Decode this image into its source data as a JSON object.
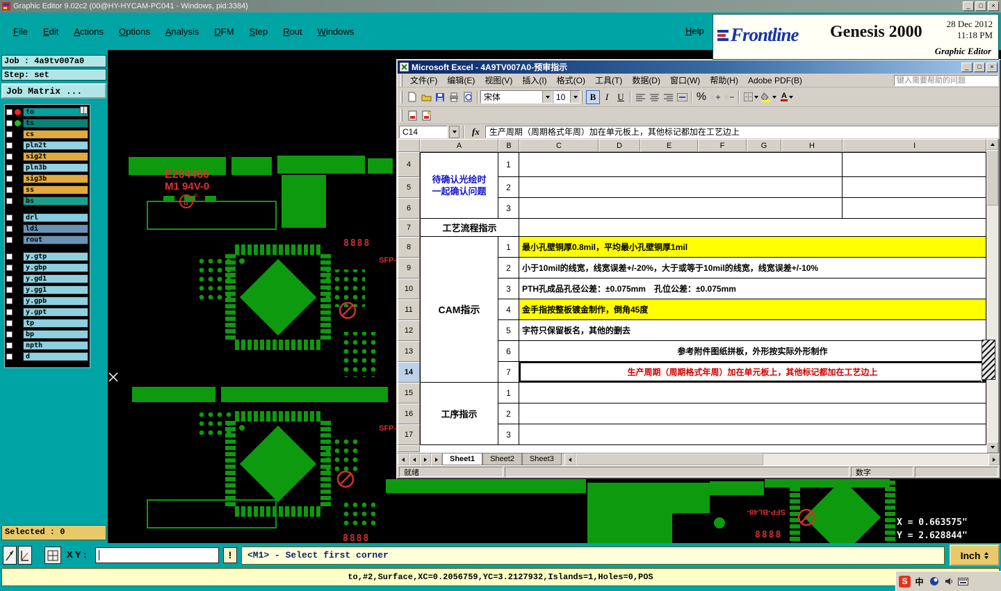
{
  "window": {
    "title": "Graphic Editor 9.02c2 (00@HY-HYCAM-PC041 - Windows, pid:3384)"
  },
  "window_controls": {
    "min": "_",
    "max": "□",
    "close": "×"
  },
  "menu": {
    "items": [
      "File",
      "Edit",
      "Actions",
      "Options",
      "Analysis",
      "DFM",
      "Step",
      "Rout",
      "Windows"
    ],
    "help": "Help"
  },
  "branding": {
    "logo": "Frontline",
    "product": "Genesis 2000",
    "date": "28 Dec 2012",
    "time": "11:18 PM",
    "subtitle": "Graphic Editor"
  },
  "sidebar": {
    "job": "Job : 4a9tv007a0",
    "step": "Step: set",
    "matrix_button": "Job Matrix ...",
    "layers": [
      {
        "name": "to",
        "color": "#00A2A2",
        "dot": "#FF2020"
      },
      {
        "name": "ts",
        "color": "#0B8278",
        "dot": "#20C020"
      },
      {
        "name": "cs",
        "color": "#E2A93C",
        "dot": ""
      },
      {
        "name": "pln2t",
        "color": "#92D2E2",
        "dot": ""
      },
      {
        "name": "sig2t",
        "color": "#E2A93C",
        "dot": ""
      },
      {
        "name": "pln3b",
        "color": "#92D2E2",
        "dot": ""
      },
      {
        "name": "sig3b",
        "color": "#E2A93C",
        "dot": ""
      },
      {
        "name": "ss",
        "color": "#E2A93C",
        "dot": ""
      },
      {
        "name": "bs",
        "color": "#18A28E",
        "dot": ""
      },
      {
        "name": "drl",
        "color": "#84CCDE",
        "dot": ""
      },
      {
        "name": "ldi",
        "color": "#6A92B6",
        "dot": ""
      },
      {
        "name": "rout",
        "color": "#6A92B6",
        "dot": ""
      },
      {
        "name": "y.gtp",
        "color": "#8ED0E0",
        "dot": ""
      },
      {
        "name": "y.gbp",
        "color": "#8ED0E0",
        "dot": ""
      },
      {
        "name": "y.gd1",
        "color": "#8ED0E0",
        "dot": ""
      },
      {
        "name": "y.gg1",
        "color": "#8ED0E0",
        "dot": ""
      },
      {
        "name": "y.gpb",
        "color": "#8ED0E0",
        "dot": ""
      },
      {
        "name": "y.gpt",
        "color": "#8ED0E0",
        "dot": ""
      },
      {
        "name": "tp",
        "color": "#8ED0E0",
        "dot": ""
      },
      {
        "name": "bp",
        "color": "#8ED0E0",
        "dot": ""
      },
      {
        "name": "npth",
        "color": "#8ED0E0",
        "dot": ""
      },
      {
        "name": "d",
        "color": "#8ED0E0",
        "dot": ""
      }
    ]
  },
  "pcb": {
    "part_number": "E204460",
    "ul_code": "M1 94V-0",
    "ul_mark": "u",
    "reg": "®",
    "digits": "8888",
    "ref_label": "SFP-BL48-"
  },
  "coords": {
    "x": "X = 0.663575\"",
    "y": "Y = 2.628844\""
  },
  "excel": {
    "title": "Microsoft Excel - 4A9TV007A0-预审指示",
    "menu": [
      "文件(F)",
      "编辑(E)",
      "视图(V)",
      "插入(I)",
      "格式(O)",
      "工具(T)",
      "数据(D)",
      "窗口(W)",
      "帮助(H)",
      "Adobe PDF(B)"
    ],
    "help_box": "键入需要帮助的问题",
    "tb": {
      "font": "宋体",
      "size": "10",
      "bold": "B",
      "italic": "I",
      "underline": "U",
      "percent": "%",
      "font_color_a": "A",
      "fx": "fx"
    },
    "name_box": "C14",
    "formula": "生产周期（周期格式年周）加在单元板上，其他标记都加在工艺边上",
    "cols": [
      "A",
      "B",
      "C",
      "D",
      "E",
      "F",
      "G",
      "H",
      "I"
    ],
    "rows": [
      "4",
      "5",
      "6",
      "7",
      "8",
      "9",
      "10",
      "11",
      "12",
      "13",
      "14",
      "15",
      "16",
      "17"
    ],
    "a4_1": "待确认光绘时",
    "a4_2": "一起确认问题",
    "b4": "1",
    "b5": "2",
    "b6": "3",
    "a7": "工艺流程指示",
    "a8": "CAM指示",
    "b8": "1",
    "b9": "2",
    "b10": "3",
    "b11": "4",
    "b12": "5",
    "b13": "6",
    "b14": "7",
    "c8": "最小孔壁铜厚0.8mil，平均最小孔壁铜厚1mil",
    "c9": "小于10mil的线宽，线宽误差+/-20%，大于或等于10mil的线宽，线宽误差+/-10%",
    "c10": "PTH孔成品孔径公差：±0.075mm　孔位公差：±0.075mm",
    "c11": "金手指按整板镀金制作，倒角45度",
    "c12": "字符只保留板名，其他的删去",
    "c13": "参考附件图纸拼板，外形按实际外形制作",
    "c14": "生产周期（周期格式年周）加在单元板上，其他标记都加在工艺边上",
    "a15": "工序指示",
    "b15": "1",
    "b16": "2",
    "b17": "3",
    "tabs": [
      "Sheet1",
      "Sheet2",
      "Sheet3"
    ],
    "status_ready": "就绪",
    "status_num": "数字"
  },
  "bottom": {
    "selected": "Selected : 0",
    "xy_label": "X Y :",
    "alert": "!",
    "prompt": "<M1> - Select first corner",
    "units": "Inch"
  },
  "statusline": "to,#2,Surface,XC=0.2056759,YC=3.2127932,Islands=1,Holes=0,POS",
  "tray": {
    "sogou": "S",
    "ime": "中"
  }
}
